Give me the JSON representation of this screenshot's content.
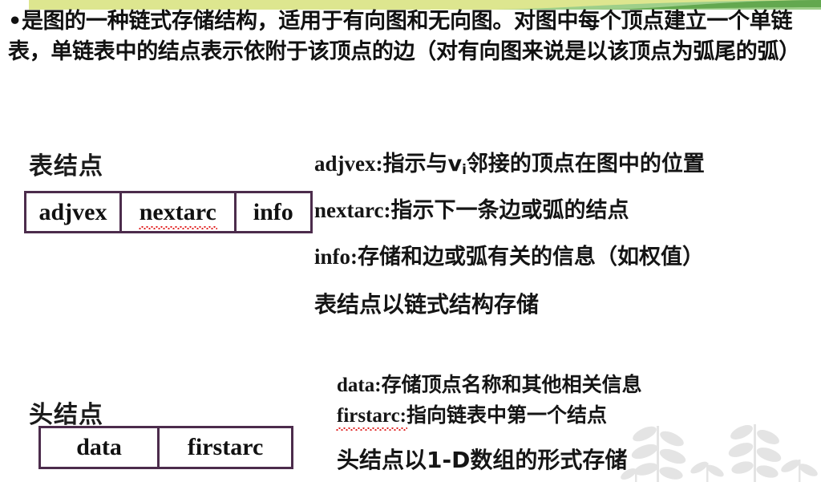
{
  "slide": {
    "intro_paragraph": "•是图的一种链式存储结构，适用于有向图和无向图。对图中每个顶点建立一个单链表，单链表中的结点表示依附于该顶点的边（对有向图来说是以该顶点为弧尾的弧）",
    "accent_border_color": "#4c2c4c",
    "band_light_green": "#dde68f",
    "band_mid_green": "#8cc07a",
    "band_dark_green": "#5ba14f",
    "watermark_color": "#e3e3e3"
  },
  "list_node": {
    "label": "表结点",
    "cells": [
      {
        "name": "adjvex",
        "text": "adjvex",
        "misspelled": false
      },
      {
        "name": "nextarc",
        "text": "nextarc",
        "misspelled": true
      },
      {
        "name": "info",
        "text": "info",
        "misspelled": false
      }
    ],
    "descriptions": [
      {
        "term": "adjvex:",
        "sub_term_html": true,
        "body_a": "指示与v",
        "sub": "i",
        "body_b": "邻接的顶点在图中的位置"
      },
      {
        "term": "nextarc:",
        "sub_term_html": false,
        "body": "指示下一条边或弧的结点"
      },
      {
        "term": "info:",
        "sub_term_html": false,
        "body": "存储和边或弧有关的信息（如权值）"
      }
    ],
    "storage_note": "表结点以链式结构存储"
  },
  "head_node": {
    "label": "头结点",
    "cells": [
      {
        "name": "data",
        "text": "data",
        "misspelled": false
      },
      {
        "name": "firstarc",
        "text": "firstarc",
        "misspelled": false
      }
    ],
    "descriptions": [
      {
        "term": "data:",
        "body": "存储顶点名称和其他相关信息",
        "misspelled": false
      },
      {
        "term": "firstarc:",
        "body": "指向链表中第一个结点",
        "misspelled": true
      }
    ],
    "storage_note": "头结点以1-D数组的形式存储"
  }
}
